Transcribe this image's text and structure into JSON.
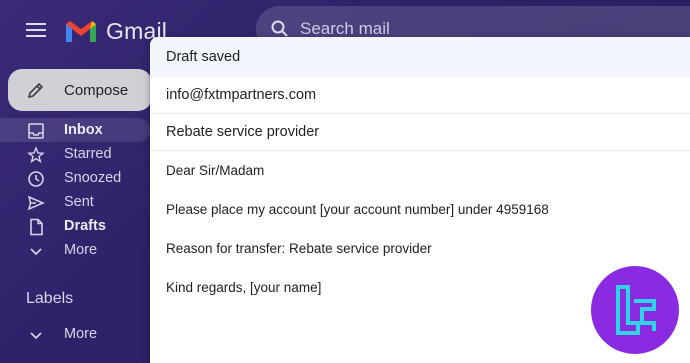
{
  "app": {
    "name": "Gmail"
  },
  "search": {
    "placeholder": "Search mail"
  },
  "sidebar": {
    "compose_label": "Compose",
    "items": [
      {
        "label": "Inbox",
        "icon": "inbox-icon",
        "bold": true,
        "active": true
      },
      {
        "label": "Starred",
        "icon": "star-icon"
      },
      {
        "label": "Snoozed",
        "icon": "clock-icon"
      },
      {
        "label": "Sent",
        "icon": "send-icon"
      },
      {
        "label": "Drafts",
        "icon": "draft-icon",
        "bold": true
      },
      {
        "label": "More",
        "icon": "chevron-down-icon"
      }
    ],
    "labels_heading": "Labels",
    "labels_more": "More"
  },
  "compose": {
    "title": "Draft saved",
    "to": "info@fxtmpartners.com",
    "subject": "Rebate service provider",
    "body": [
      "Dear Sir/Madam",
      "Please place my account [your account number] under 4959168",
      "Reason for transfer: Rebate service provider",
      "Kind regards, [your name]"
    ]
  },
  "colors": {
    "background": "#2e2168",
    "compose_header": "#f2f6fc",
    "badge": "#8a2be2",
    "badge_mark": "#2fd3e6"
  }
}
